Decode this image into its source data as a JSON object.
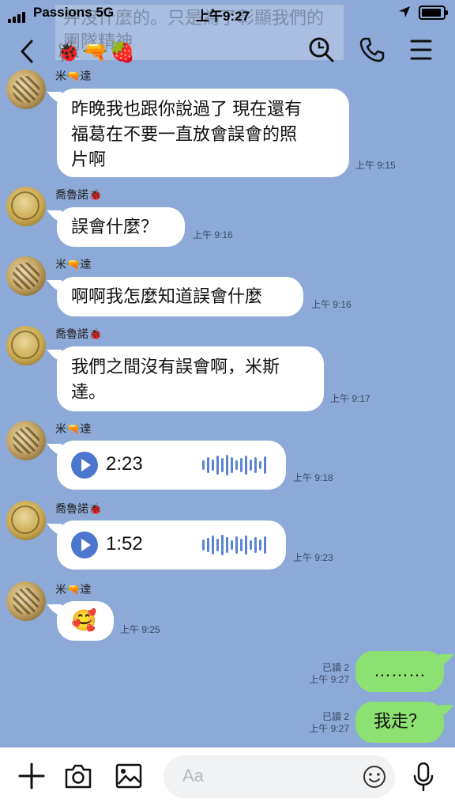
{
  "status_bar": {
    "carrier": "Passions",
    "network": "5G",
    "time": "上午9:27"
  },
  "header": {
    "title_emojis": "🐞🔫🍓",
    "ghost_text": "并沒什麼的。只是為了彰顯我們的團隊精神"
  },
  "messages": [
    {
      "sender": "米🔫達",
      "text_lines": [
        "昨晚我也跟你說過了 現在還有",
        "福葛在不要一直放會誤會的照",
        "片啊"
      ],
      "time": "上午 9:15"
    },
    {
      "sender": "喬魯諾🐞",
      "text": "誤會什麼？",
      "time": "上午 9:16"
    },
    {
      "sender": "米🔫達",
      "text": "啊啊我怎麼知道誤會什麼",
      "time": "上午 9:16"
    },
    {
      "sender": "喬魯諾🐞",
      "text_lines": [
        "我們之間沒有誤會啊，米斯",
        "達。"
      ],
      "time": "上午 9:17"
    },
    {
      "sender": "米🔫達",
      "voice_duration": "2:23",
      "time": "上午 9:18"
    },
    {
      "sender": "喬魯諾🐞",
      "voice_duration": "1:52",
      "time": "上午 9:23"
    },
    {
      "sender": "米🔫達",
      "text": "🥰",
      "time": "上午 9:25"
    },
    {
      "sender": "me",
      "text": "………",
      "read": "已讀 2",
      "time": "上午 9:27"
    },
    {
      "sender": "me",
      "text": "我走？",
      "read": "已讀 2",
      "time": "上午 9:27"
    }
  ],
  "input": {
    "placeholder": "Aa"
  },
  "colors": {
    "chat_background": "#8ca9d7",
    "my_bubble": "#8de172",
    "voice_play": "#4d76cf"
  }
}
